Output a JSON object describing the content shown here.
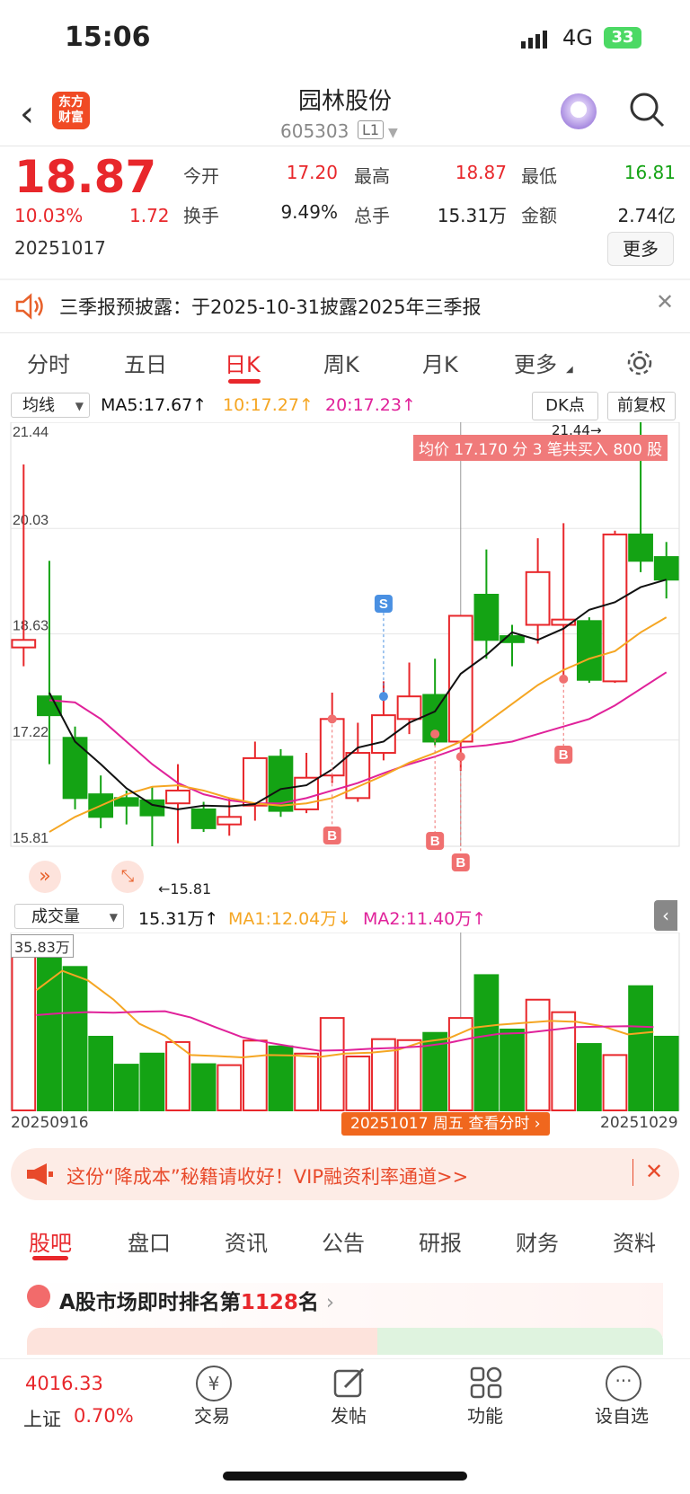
{
  "status_bar": {
    "time": "15:06",
    "network": "4G",
    "battery": "33"
  },
  "header": {
    "logo_line1": "东方",
    "logo_line2": "财富",
    "stock_name": "园林股份",
    "stock_code": "605303",
    "level": "L1"
  },
  "quote": {
    "price": "18.87",
    "change_pct": "10.03%",
    "change": "1.72",
    "date": "20251017",
    "open_label": "今开",
    "open": "17.20",
    "high_label": "最高",
    "high": "18.87",
    "low_label": "最低",
    "low": "16.81",
    "turnover_label": "换手",
    "turnover": "9.49%",
    "volume_label": "总手",
    "volume": "15.31万",
    "amount_label": "金额",
    "amount": "2.74亿",
    "more_label": "更多"
  },
  "notice": {
    "text": "三季报预披露：于2025-10-31披露2025年三季报"
  },
  "chart_tabs": {
    "t1": "分时",
    "t2": "五日",
    "t3": "日K",
    "t4": "周K",
    "t5": "月K",
    "t6": "更多"
  },
  "indicators": {
    "ma_select": "均线",
    "ma5": "MA5:17.67↑",
    "ma10": "10:17.27↑",
    "ma20": "20:17.23↑",
    "dk": "DK点",
    "adjust": "前复权",
    "tooltip": "均价 17.170 分 3 笔共买入 800 股",
    "vol_select": "成交量",
    "vol": "15.31万↑",
    "vol_ma1": "MA1:12.04万↓",
    "vol_ma2": "MA2:11.40万↑",
    "vol_max": "35.83万",
    "start_date": "20250916",
    "end_date": "20251029",
    "cursor_label": "20251017 周五 查看分时",
    "high_mark": "21.44→",
    "low_mark": "←15.81"
  },
  "colors": {
    "up": "#e8272b",
    "down": "#14a314",
    "ma5": "#111111",
    "ma10": "#f5a623",
    "ma20": "#e0229a"
  },
  "chart_data": {
    "type": "candlestick",
    "y_ticks": [
      "21.44",
      "20.03",
      "18.63",
      "17.22",
      "15.81"
    ],
    "ylim": [
      15.81,
      21.44
    ],
    "candles": [
      {
        "o": 18.45,
        "c": 18.55,
        "h": 20.88,
        "l": 18.2
      },
      {
        "o": 17.8,
        "c": 17.55,
        "h": 19.6,
        "l": 16.9
      },
      {
        "o": 17.25,
        "c": 16.45,
        "h": 17.4,
        "l": 16.3
      },
      {
        "o": 16.5,
        "c": 16.2,
        "h": 16.75,
        "l": 16.05
      },
      {
        "o": 16.45,
        "c": 16.35,
        "h": 16.55,
        "l": 16.1
      },
      {
        "o": 16.42,
        "c": 16.22,
        "h": 16.6,
        "l": 15.81
      },
      {
        "o": 16.38,
        "c": 16.55,
        "h": 16.9,
        "l": 15.85
      },
      {
        "o": 16.3,
        "c": 16.05,
        "h": 16.4,
        "l": 16.0
      },
      {
        "o": 16.1,
        "c": 16.2,
        "h": 16.45,
        "l": 15.95
      },
      {
        "o": 16.35,
        "c": 16.98,
        "h": 17.2,
        "l": 16.15
      },
      {
        "o": 17.0,
        "c": 16.28,
        "h": 17.1,
        "l": 16.2
      },
      {
        "o": 16.3,
        "c": 16.72,
        "h": 17.05,
        "l": 16.25
      },
      {
        "o": 16.75,
        "c": 17.5,
        "h": 17.85,
        "l": 16.65
      },
      {
        "o": 16.45,
        "c": 17.05,
        "h": 17.45,
        "l": 16.4
      },
      {
        "o": 17.05,
        "c": 17.55,
        "h": 18.0,
        "l": 16.95
      },
      {
        "o": 17.5,
        "c": 17.8,
        "h": 18.25,
        "l": 17.3
      },
      {
        "o": 17.82,
        "c": 17.2,
        "h": 18.3,
        "l": 17.15
      },
      {
        "o": 17.2,
        "c": 18.87,
        "h": 18.87,
        "l": 16.81
      },
      {
        "o": 19.15,
        "c": 18.55,
        "h": 19.75,
        "l": 18.3
      },
      {
        "o": 18.6,
        "c": 18.52,
        "h": 18.75,
        "l": 18.2
      },
      {
        "o": 18.75,
        "c": 19.45,
        "h": 19.9,
        "l": 18.5
      },
      {
        "o": 18.75,
        "c": 18.82,
        "h": 20.1,
        "l": 18.05
      },
      {
        "o": 18.8,
        "c": 18.02,
        "h": 18.85,
        "l": 17.98
      },
      {
        "o": 18.0,
        "c": 19.95,
        "h": 20.0,
        "l": 17.98
      },
      {
        "o": 19.95,
        "c": 19.6,
        "h": 21.44,
        "l": 19.45
      },
      {
        "o": 19.65,
        "c": 19.35,
        "h": 19.85,
        "l": 19.1
      }
    ],
    "ma5": [
      17.85,
      17.2,
      16.9,
      16.58,
      16.36,
      16.3,
      16.35,
      16.34,
      16.37,
      16.57,
      16.62,
      16.83,
      17.12,
      17.2,
      17.45,
      17.6,
      18.1,
      18.35,
      18.65,
      18.55,
      18.7,
      18.95,
      19.05,
      19.25,
      19.35
    ],
    "ma10": [
      16.0,
      16.2,
      16.35,
      16.5,
      16.6,
      16.62,
      16.55,
      16.45,
      16.38,
      16.35,
      16.38,
      16.45,
      16.6,
      16.75,
      16.92,
      17.05,
      17.2,
      17.45,
      17.7,
      17.95,
      18.15,
      18.3,
      18.4,
      18.65,
      18.85
    ],
    "ma20": [
      17.75,
      17.72,
      17.5,
      17.2,
      16.9,
      16.65,
      16.5,
      16.42,
      16.38,
      16.38,
      16.45,
      16.55,
      16.65,
      16.78,
      16.9,
      17.0,
      17.12,
      17.15,
      17.2,
      17.3,
      17.4,
      17.5,
      17.68,
      17.9,
      18.12
    ],
    "volume": [
      35.8,
      32.4,
      29.8,
      15.3,
      9.5,
      11.8,
      14.2,
      9.6,
      9.4,
      14.5,
      13.3,
      11.8,
      19.2,
      11.2,
      14.8,
      14.6,
      16.1,
      19.2,
      28.1,
      16.8,
      23.0,
      20.4,
      13.8,
      11.5,
      25.8,
      15.31
    ],
    "vol_ma1": [
      25.0,
      29.0,
      27.0,
      23.0,
      18.0,
      15.5,
      11.5,
      11.3,
      11.0,
      11.5,
      11.4,
      11.1,
      11.8,
      12.0,
      12.5,
      14.2,
      14.9,
      17.2,
      17.8,
      18.2,
      18.6,
      18.4,
      17.5,
      15.8,
      16.3
    ],
    "vol_ma2": [
      19.8,
      20.2,
      20.4,
      20.3,
      20.5,
      20.6,
      19.3,
      17.2,
      15.2,
      14.1,
      13.2,
      12.4,
      12.5,
      12.8,
      13.0,
      13.3,
      14.0,
      15.1,
      15.9,
      16.1,
      16.7,
      17.3,
      17.4,
      17.5,
      17.3
    ]
  },
  "ad": {
    "text": "这份“降成本”秘籍请收好！VIP融资利率通道>>"
  },
  "bottom_tabs": {
    "t1": "股吧",
    "t2": "盘口",
    "t3": "资讯",
    "t4": "公告",
    "t5": "研报",
    "t6": "财务",
    "t7": "资料"
  },
  "rank": {
    "prefix": "A股市场即时排名第",
    "number": "1128",
    "suffix": "名"
  },
  "bottom_nav": {
    "index_value": "4016.33",
    "index_name": "上证",
    "index_pct": "0.70%",
    "n2": "交易",
    "n3": "发帖",
    "n4": "功能",
    "n5": "设自选"
  }
}
